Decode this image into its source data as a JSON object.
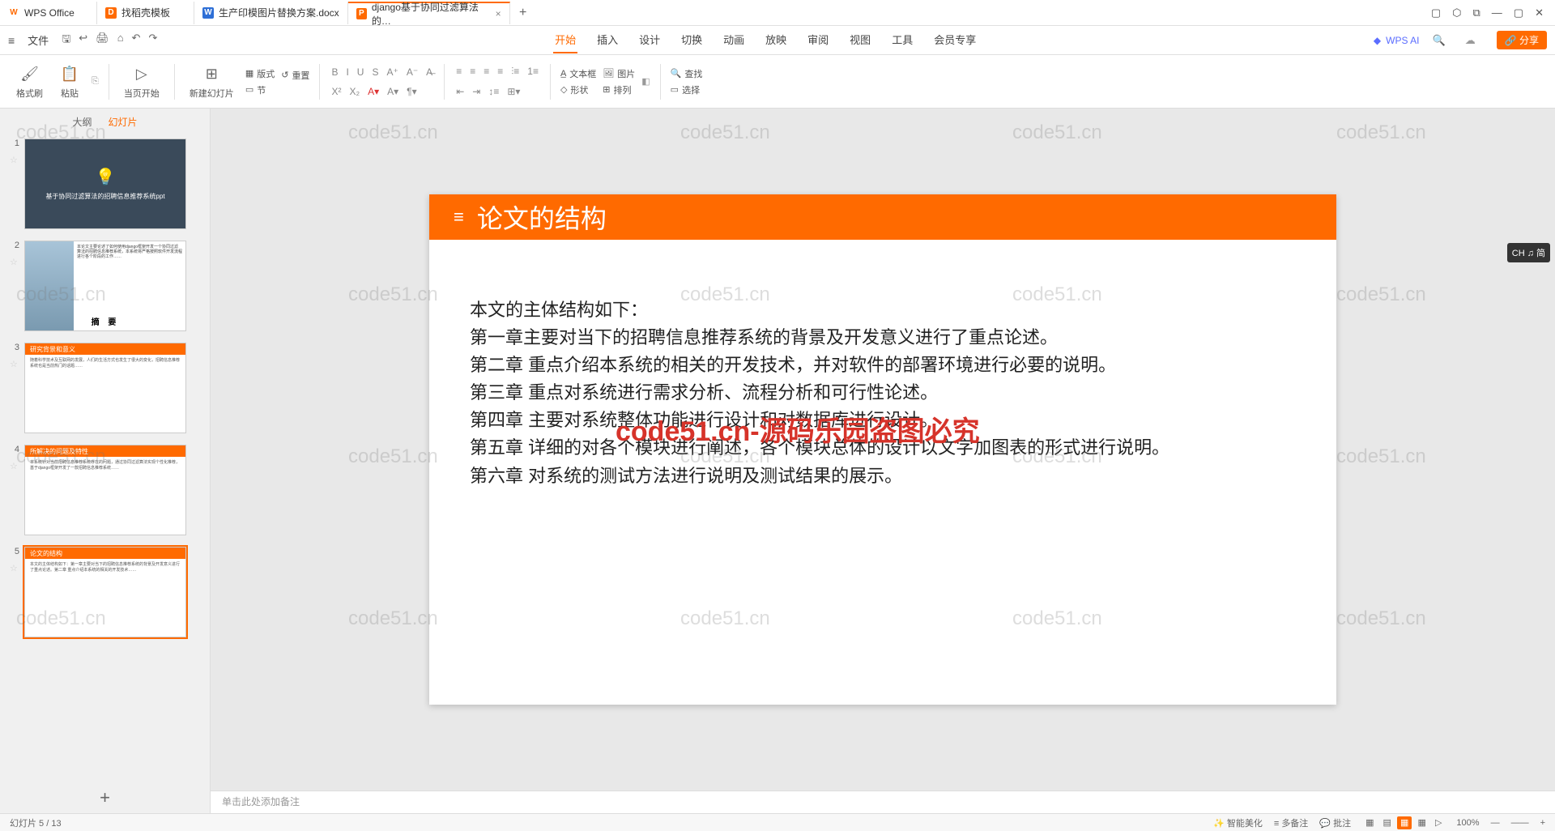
{
  "titlebar": {
    "tabs": [
      {
        "icon": "W",
        "label": "WPS Office",
        "cls": "wps-ico"
      },
      {
        "icon": "D",
        "label": "找稻壳模板",
        "cls": "d-ico"
      },
      {
        "icon": "W",
        "label": "生产印模图片替换方案.docx",
        "cls": "w-ico"
      },
      {
        "icon": "P",
        "label": "django基于协同过滤算法的…",
        "cls": "p-ico",
        "active": true
      }
    ],
    "add": "+",
    "win": [
      "▢",
      "⬡",
      "⧉",
      "—",
      "▢",
      "✕"
    ]
  },
  "menubar": {
    "file": "文件",
    "qat": [
      "🖫",
      "↩",
      "🖨",
      "⌂",
      "↶",
      "↷"
    ],
    "tabs": [
      "开始",
      "插入",
      "设计",
      "切换",
      "动画",
      "放映",
      "审阅",
      "视图",
      "工具",
      "会员专享"
    ],
    "active": "开始",
    "wpsai": "WPS AI",
    "share": "分享"
  },
  "ribbon": {
    "g1": {
      "a": "格式刷",
      "b": "粘贴"
    },
    "g2": {
      "a": "当页开始"
    },
    "g3": {
      "a": "新建幻灯片",
      "b": "版式",
      "c": "重置",
      "d": "节"
    },
    "fmt": [
      "B",
      "I",
      "U",
      "S",
      "A",
      "A",
      "X²",
      "X₂",
      "A",
      "A",
      "¶"
    ],
    "para": [
      "≡",
      "≡",
      "≡",
      "≡",
      "⫶",
      "⊞",
      "⊡",
      "⊟"
    ],
    "g4": {
      "a": "文本框",
      "b": "形状",
      "c": "图片",
      "d": "排列"
    },
    "g5": {
      "a": "查找",
      "b": "选择"
    }
  },
  "side": {
    "tabs": [
      "大纲",
      "幻灯片"
    ],
    "active": "幻灯片",
    "thumbs": [
      {
        "n": "1",
        "type": "cover",
        "title": "基于协同过滤算法的招聘信息推荐系统ppt"
      },
      {
        "n": "2",
        "type": "abs",
        "caption": "摘  要"
      },
      {
        "n": "3",
        "type": "orange",
        "bar": "研究背景和意义"
      },
      {
        "n": "4",
        "type": "orange",
        "bar": "所解决的问题及特性"
      },
      {
        "n": "5",
        "type": "orange",
        "bar": "论文的结构",
        "sel": true
      }
    ],
    "add": "+"
  },
  "slide": {
    "title": "论文的结构",
    "lines": [
      "本文的主体结构如下：",
      "第一章主要对当下的招聘信息推荐系统的背景及开发意义进行了重点论述。",
      "第二章 重点介绍本系统的相关的开发技术，并对软件的部署环境进行必要的说明。",
      "第三章 重点对系统进行需求分析、流程分析和可行性论述。",
      "第四章 主要对系统整体功能进行设计和对数据库进行设计。",
      "第五章 详细的对各个模块进行阐述，各个模块总体的设计以文字加图表的形式进行说明。",
      "第六章 对系统的测试方法进行说明及测试结果的展示。"
    ],
    "watermark_main": "code51.cn-源码乐园盗图必究",
    "watermark_bg": "code51.cn"
  },
  "notes": "单击此处添加备注",
  "status": {
    "left": "幻灯片 5 / 13",
    "right": [
      "智能美化",
      "多备注",
      "批注",
      "▦",
      "▤",
      "▦",
      "▦",
      "▷",
      "100%",
      "—",
      "——",
      "+"
    ]
  },
  "ime": "CH ♫ 简"
}
